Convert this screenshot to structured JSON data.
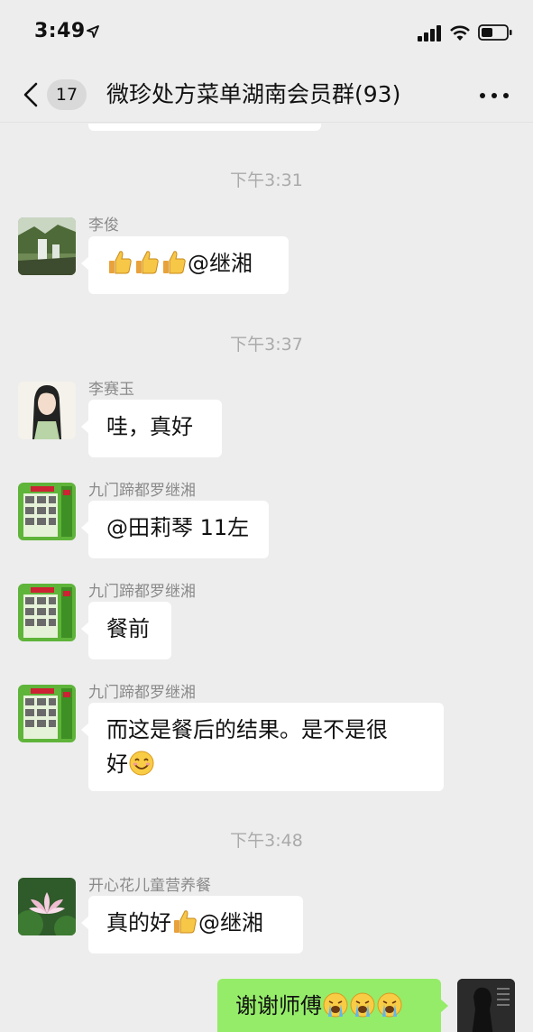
{
  "status_bar": {
    "time": "3:49"
  },
  "nav": {
    "unread_count": "17",
    "title": "微珍处方菜单湖南会员群(93)"
  },
  "messages": [
    {
      "type": "timestamp",
      "text": "下午3:31"
    },
    {
      "type": "message",
      "sender": "李俊",
      "text": "@继湘",
      "emoji_prefix": [
        "thumbs-up",
        "thumbs-up",
        "thumbs-up"
      ]
    },
    {
      "type": "timestamp",
      "text": "下午3:37"
    },
    {
      "type": "message",
      "sender": "李赛玉",
      "text": "哇，真好"
    },
    {
      "type": "message",
      "sender": "九门蹄都罗继湘",
      "text": "@田莉琴 11左"
    },
    {
      "type": "message",
      "sender": "九门蹄都罗继湘",
      "text": "餐前"
    },
    {
      "type": "message",
      "sender": "九门蹄都罗继湘",
      "text_line1": "而这是餐后的结果。是不是很",
      "text_line2": "好"
    },
    {
      "type": "timestamp",
      "text": "下午3:48"
    },
    {
      "type": "message",
      "sender": "开心花儿童营养餐",
      "text_before": "真的好",
      "text_after": "@继湘"
    },
    {
      "type": "message",
      "sender": "me",
      "text": "谢谢师傅"
    }
  ],
  "colors": {
    "background": "#ededed",
    "bubble_incoming": "#ffffff",
    "bubble_outgoing": "#95ec69",
    "sender_name": "#8a8a8a",
    "timestamp": "#aaaaaa"
  }
}
